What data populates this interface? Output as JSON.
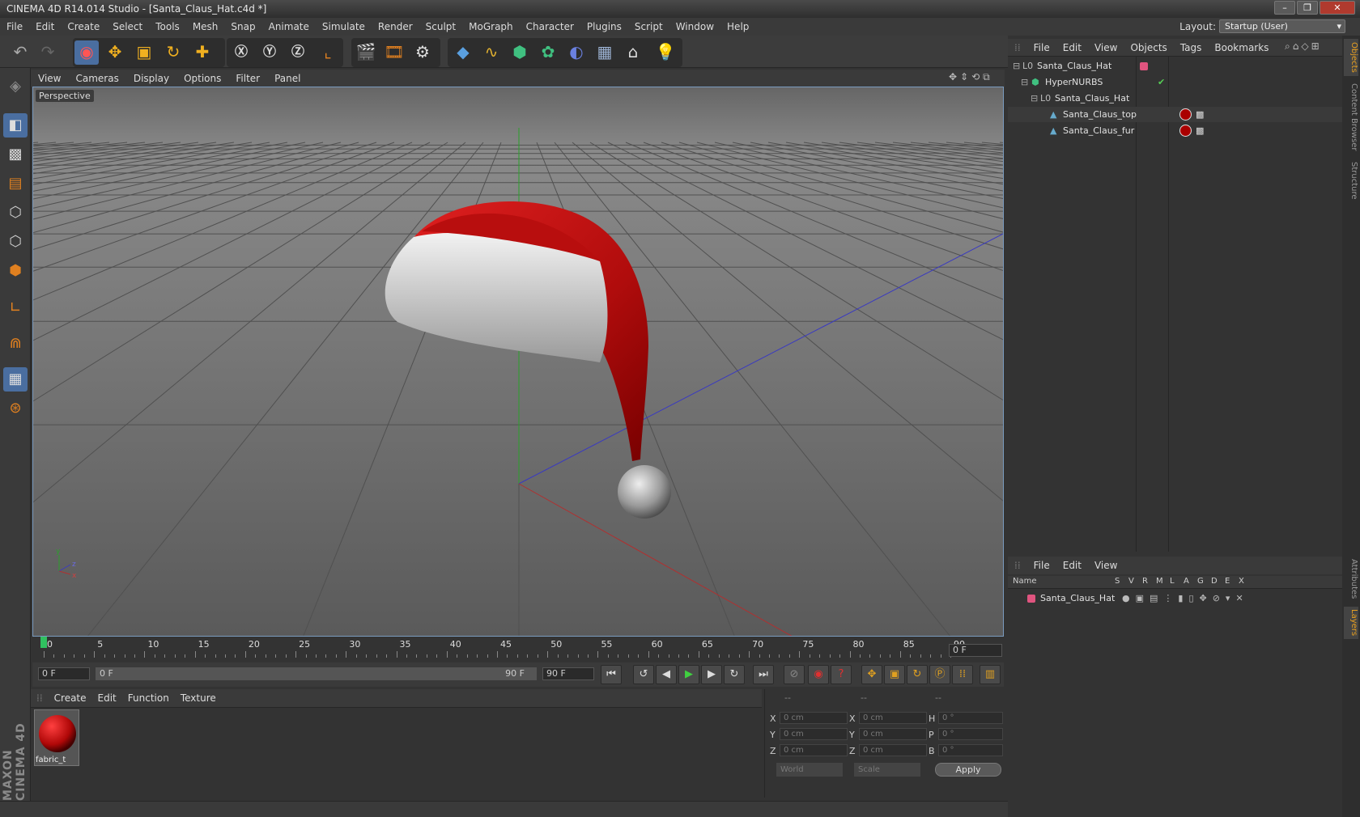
{
  "title": "CINEMA 4D R14.014 Studio - [Santa_Claus_Hat.c4d *]",
  "menubar": [
    "File",
    "Edit",
    "Create",
    "Select",
    "Tools",
    "Mesh",
    "Snap",
    "Animate",
    "Simulate",
    "Render",
    "Sculpt",
    "MoGraph",
    "Character",
    "Plugins",
    "Script",
    "Window",
    "Help"
  ],
  "layout": {
    "label": "Layout:",
    "value": "Startup (User)"
  },
  "viewport": {
    "menu": [
      "View",
      "Cameras",
      "Display",
      "Options",
      "Filter",
      "Panel"
    ],
    "label": "Perspective",
    "axis_labels": [
      "y",
      "z",
      "x"
    ]
  },
  "timeline": {
    "ticks": [
      "0",
      "5",
      "10",
      "15",
      "20",
      "25",
      "30",
      "35",
      "40",
      "45",
      "50",
      "55",
      "60",
      "65",
      "70",
      "75",
      "80",
      "85",
      "90"
    ],
    "current_frame": "0 F"
  },
  "transport": {
    "start_field": "0 F",
    "range_start": "0 F",
    "range_end": "90 F",
    "end_field": "90 F"
  },
  "material_manager": {
    "menu": [
      "Create",
      "Edit",
      "Function",
      "Texture"
    ],
    "materials": [
      {
        "name": "fabric_t"
      }
    ]
  },
  "coordinates": {
    "header": [
      "--",
      "--",
      "--"
    ],
    "rows": [
      {
        "l1": "X",
        "v1": "0 cm",
        "l2": "X",
        "v2": "0 cm",
        "l3": "H",
        "v3": "0 °"
      },
      {
        "l1": "Y",
        "v1": "0 cm",
        "l2": "Y",
        "v2": "0 cm",
        "l3": "P",
        "v3": "0 °"
      },
      {
        "l1": "Z",
        "v1": "0 cm",
        "l2": "Z",
        "v2": "0 cm",
        "l3": "B",
        "v3": "0 °"
      }
    ],
    "world": "World",
    "scale": "Scale",
    "apply": "Apply"
  },
  "object_manager": {
    "menu": [
      "File",
      "Edit",
      "View",
      "Objects",
      "Tags",
      "Bookmarks"
    ],
    "objects": [
      {
        "name": "Santa_Claus_Hat"
      },
      {
        "name": "HyperNURBS"
      },
      {
        "name": "Santa_Claus_Hat"
      },
      {
        "name": "Santa_Claus_top"
      },
      {
        "name": "Santa_Claus_fur"
      }
    ]
  },
  "layer_manager": {
    "menu": [
      "File",
      "Edit",
      "View"
    ],
    "columns": [
      "Name",
      "S",
      "V",
      "R",
      "M",
      "L",
      "A",
      "G",
      "D",
      "E",
      "X"
    ],
    "layers": [
      {
        "name": "Santa_Claus_Hat",
        "color": "#e0547f"
      }
    ]
  },
  "side_tabs": [
    "Objects",
    "Content Browser",
    "Structure",
    "Attributes",
    "Layers"
  ],
  "brand": "MAXON CINEMA 4D",
  "colors": {
    "accent": "#e8a020",
    "hat_red": "#c0100f",
    "axis_x": "#b03030",
    "axis_z": "#3030c0",
    "axis_y": "#20a020"
  }
}
